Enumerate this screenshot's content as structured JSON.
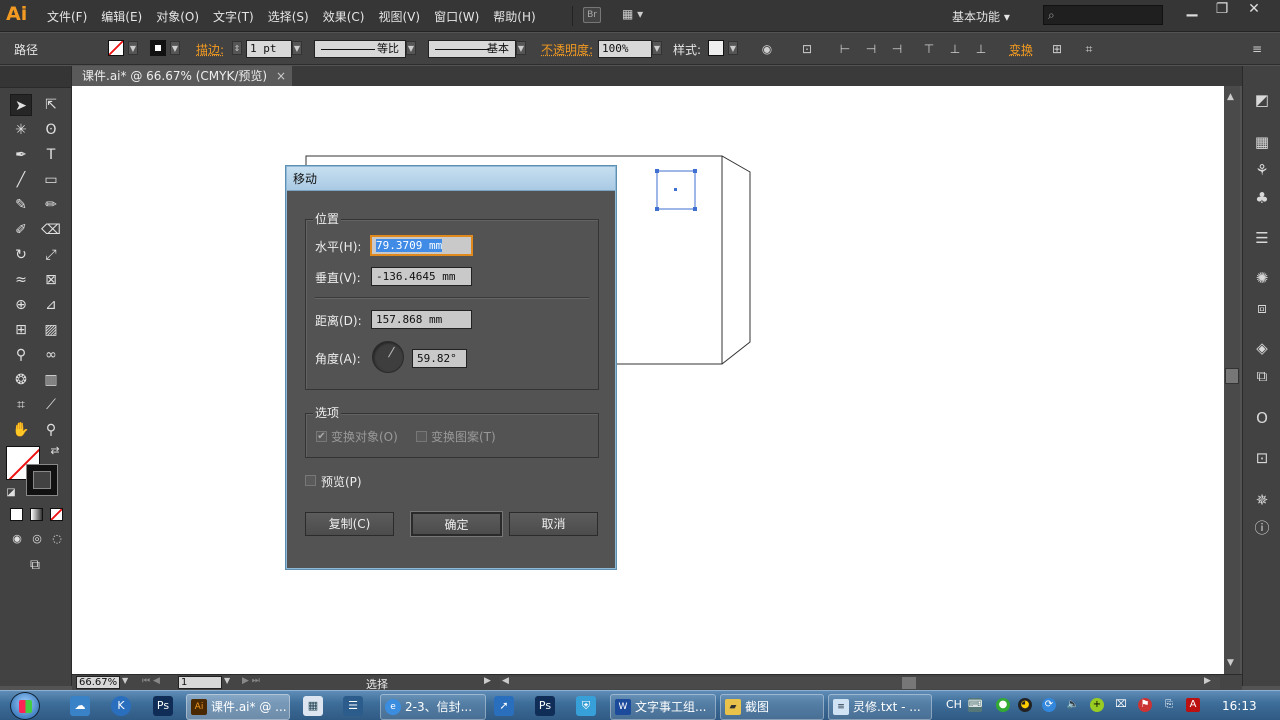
{
  "app": {
    "logo": "Ai"
  },
  "menu": [
    "文件(F)",
    "编辑(E)",
    "对象(O)",
    "文字(T)",
    "选择(S)",
    "效果(C)",
    "视图(V)",
    "窗口(W)",
    "帮助(H)"
  ],
  "topbar": {
    "bridge_label": "Br",
    "workspace": "基本功能 ▾",
    "search_placeholder": "",
    "min": "▁",
    "max": "❐",
    "close": "✕"
  },
  "control_bar": {
    "object_type": "路径",
    "stroke_label": "描边:",
    "stroke_weight": "1 pt",
    "stroke_profile": "等比",
    "brush": "基本",
    "opacity_label": "不透明度:",
    "opacity": "100%",
    "style_label": "样式:",
    "transform_label": "变换"
  },
  "document_tab": {
    "title": "课件.ai* @ 66.67% (CMYK/预览)",
    "close": "×"
  },
  "status_bar": {
    "zoom": "66.67%",
    "page": "1",
    "tool": "选择"
  },
  "dialog": {
    "title": "移动",
    "position_group": "位置",
    "horizontal_label": "水平(H):",
    "horizontal_value": "79.3709 mm",
    "vertical_label": "垂直(V):",
    "vertical_value": "-136.4645 mm",
    "distance_label": "距离(D):",
    "distance_value": "157.868 mm",
    "angle_label": "角度(A):",
    "angle_value": "59.82°",
    "angle_degrees": 59.82,
    "options_group": "选项",
    "transform_objects": "变换对象(O)",
    "transform_objects_checked": true,
    "transform_patterns": "变换图案(T)",
    "transform_patterns_checked": false,
    "preview": "预览(P)",
    "preview_checked": false,
    "copy_button": "复制(C)",
    "ok_button": "确定",
    "cancel_button": "取消"
  },
  "taskbar": {
    "apps": [
      "课件.ai* @ ...",
      "2-3、信封...",
      "文字事工组...",
      "截图",
      "灵修.txt - ..."
    ],
    "lang": "CH",
    "clock": "16:13"
  },
  "colors": {
    "accent_orange": "#f29a21",
    "dialog_title": "#b6d3ea",
    "selection_blue": "#3f6fd1"
  }
}
